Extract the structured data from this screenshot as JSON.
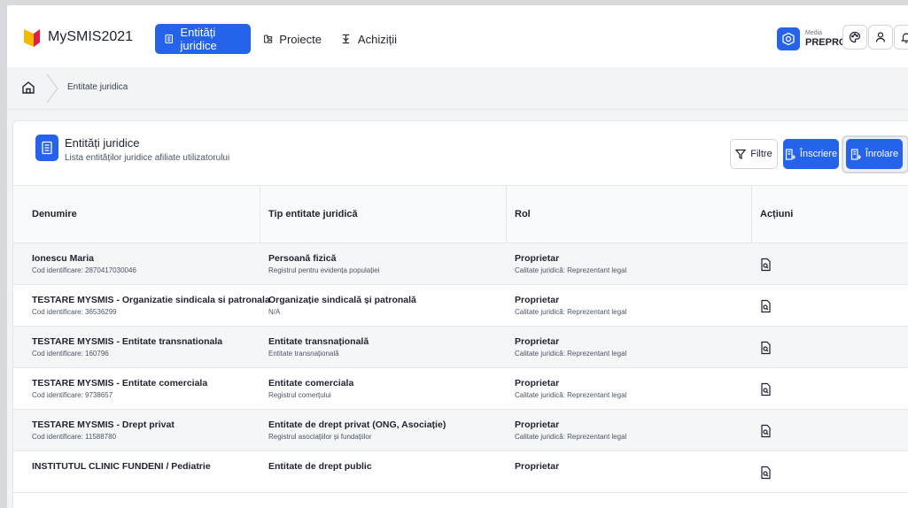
{
  "app": {
    "title": "MySMIS2021"
  },
  "nav": [
    {
      "label": "Entități juridice",
      "icon": "building-icon",
      "active": true
    },
    {
      "label": "Proiecte",
      "icon": "projects-icon",
      "active": false
    },
    {
      "label": "Achiziții",
      "icon": "acquisitions-icon",
      "active": false
    }
  ],
  "environment": {
    "small": "Media",
    "name": "PREPROD"
  },
  "breadcrumb": {
    "current": "Entitate juridica"
  },
  "card": {
    "title": "Entități juridice",
    "subtitle": "Lista entităților juridice afiliate utilizatorului",
    "filter_label": "Filtre",
    "register_label": "Înscriere",
    "enroll_label": "Înrolare"
  },
  "table": {
    "columns": [
      "Denumire",
      "Tip entitate juridică",
      "Rol",
      "Acțiuni"
    ],
    "rows": [
      {
        "name": "Ionescu Maria",
        "code": "Cod identificare: 2870417030046",
        "type": "Persoană fizică",
        "type_sub": "Registrul pentru evidența populației",
        "role": "Proprietar",
        "role_sub": "Calitate juridică: Reprezentant legal"
      },
      {
        "name": "TESTARE MYSMIS - Organizatie sindicala si patronala",
        "code": "Cod identificare: 36536299",
        "type": "Organizație sindicală și patronală",
        "type_sub": "N/A",
        "role": "Proprietar",
        "role_sub": "Calitate juridică: Reprezentant legal"
      },
      {
        "name": "TESTARE MYSMIS - Entitate transnationala",
        "code": "Cod identificare: 160796",
        "type": "Entitate transnațională",
        "type_sub": "Entitate transnațională",
        "role": "Proprietar",
        "role_sub": "Calitate juridică: Reprezentant legal"
      },
      {
        "name": "TESTARE MYSMIS - Entitate comerciala",
        "code": "Cod identificare: 9738657",
        "type": "Entitate comerciala",
        "type_sub": "Registrul comerțului",
        "role": "Proprietar",
        "role_sub": "Calitate juridică: Reprezentant legal"
      },
      {
        "name": "TESTARE MYSMIS - Drept privat",
        "code": "Cod identificare: 11588780",
        "type": "Entitate de drept privat (ONG, Asociație)",
        "type_sub": "Registrul asociațiilor și fundațiilor",
        "role": "Proprietar",
        "role_sub": "Calitate juridică: Reprezentant legal"
      },
      {
        "name": "INSTITUTUL CLINIC FUNDENI / Pediatrie",
        "code": "",
        "type": "Entitate de drept public",
        "type_sub": "",
        "role": "Proprietar",
        "role_sub": ""
      }
    ]
  },
  "colors": {
    "accent": "#2563eb",
    "logo_yellow": "#f5b800",
    "logo_red": "#e11d48"
  }
}
